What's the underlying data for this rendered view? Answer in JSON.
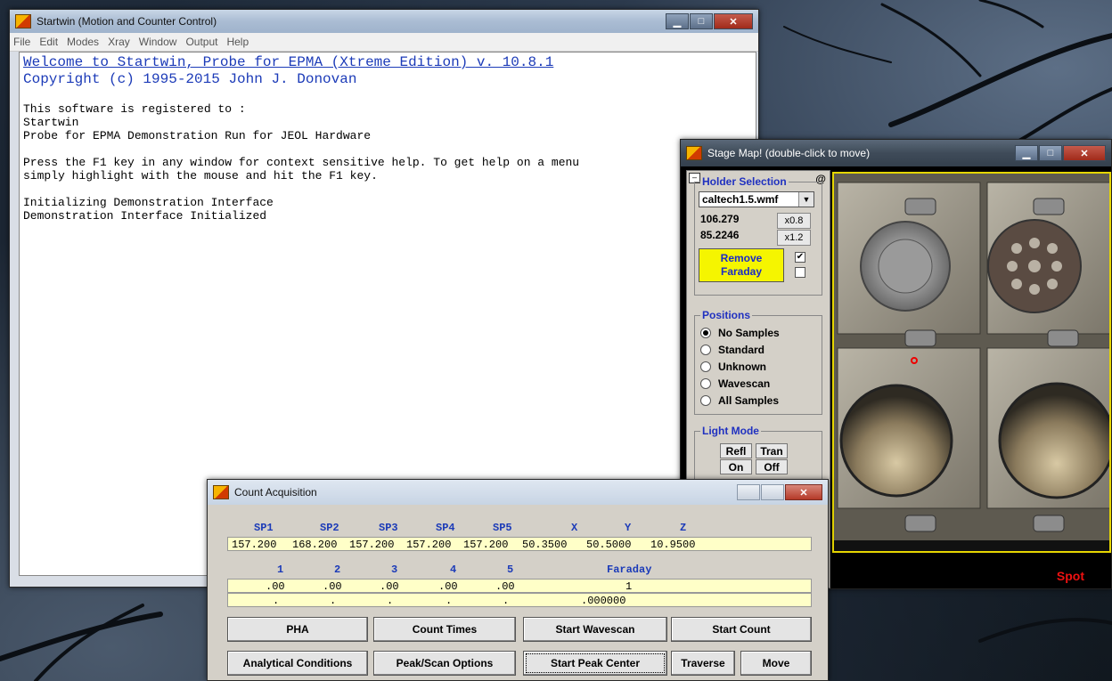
{
  "startwin": {
    "title": "Startwin (Motion and Counter Control)",
    "menu": [
      "File",
      "Edit",
      "Modes",
      "Xray",
      "Window",
      "Output",
      "Help"
    ],
    "welcome": "Welcome to Startwin, Probe for EPMA (Xtreme Edition) v. 10.8.1",
    "copyright": "Copyright (c) 1995-2015 John J. Donovan",
    "lines": [
      "This software is registered to :",
      "Startwin",
      "Probe for EPMA Demonstration Run for JEOL Hardware",
      "",
      "Press the F1 key in any window for context sensitive help. To get help on a menu",
      "simply highlight with the mouse and hit the F1 key.",
      "",
      "Initializing Demonstration Interface",
      "Demonstration Interface Initialized"
    ]
  },
  "stagemap": {
    "title": "Stage Map! (double-click to move)",
    "holder_label": "Holder Selection",
    "holder_value": "caltech1.5.wmf",
    "coord_x": "106.279",
    "coord_y": "85.2246",
    "zoom_out": "x0.8",
    "zoom_in": "x1.2",
    "remove_faraday_1": "Remove",
    "remove_faraday_2": "Faraday",
    "positions_label": "Positions",
    "positions": [
      "No Samples",
      "Standard",
      "Unknown",
      "Wavescan",
      "All Samples"
    ],
    "positions_selected": "No Samples",
    "light_label": "Light Mode",
    "refl": "Refl",
    "tran": "Tran",
    "on": "On",
    "off": "Off",
    "spot": "Spot",
    "at_symbol": "@"
  },
  "countacq": {
    "title": "Count Acquisition",
    "spec_headers": [
      "SP1",
      "SP2",
      "SP3",
      "SP4",
      "SP5",
      "X",
      "Y",
      "Z"
    ],
    "spec_values": [
      "157.200",
      "168.200",
      "157.200",
      "157.200",
      "157.200",
      "50.3500",
      "50.5000",
      "10.9500"
    ],
    "count_headers": [
      "1",
      "2",
      "3",
      "4",
      "5",
      "Faraday"
    ],
    "count_values": [
      ".00",
      ".00",
      ".00",
      ".00",
      ".00",
      "1"
    ],
    "dot_values": [
      ".",
      ".",
      ".",
      ".",
      ".",
      ".000000"
    ],
    "buttons_row1": [
      "PHA",
      "Count Times",
      "Start Wavescan",
      "Start Count"
    ],
    "buttons_row2": [
      "Analytical Conditions",
      "Peak/Scan Options",
      "Start Peak Center",
      "Traverse",
      "Move"
    ]
  }
}
